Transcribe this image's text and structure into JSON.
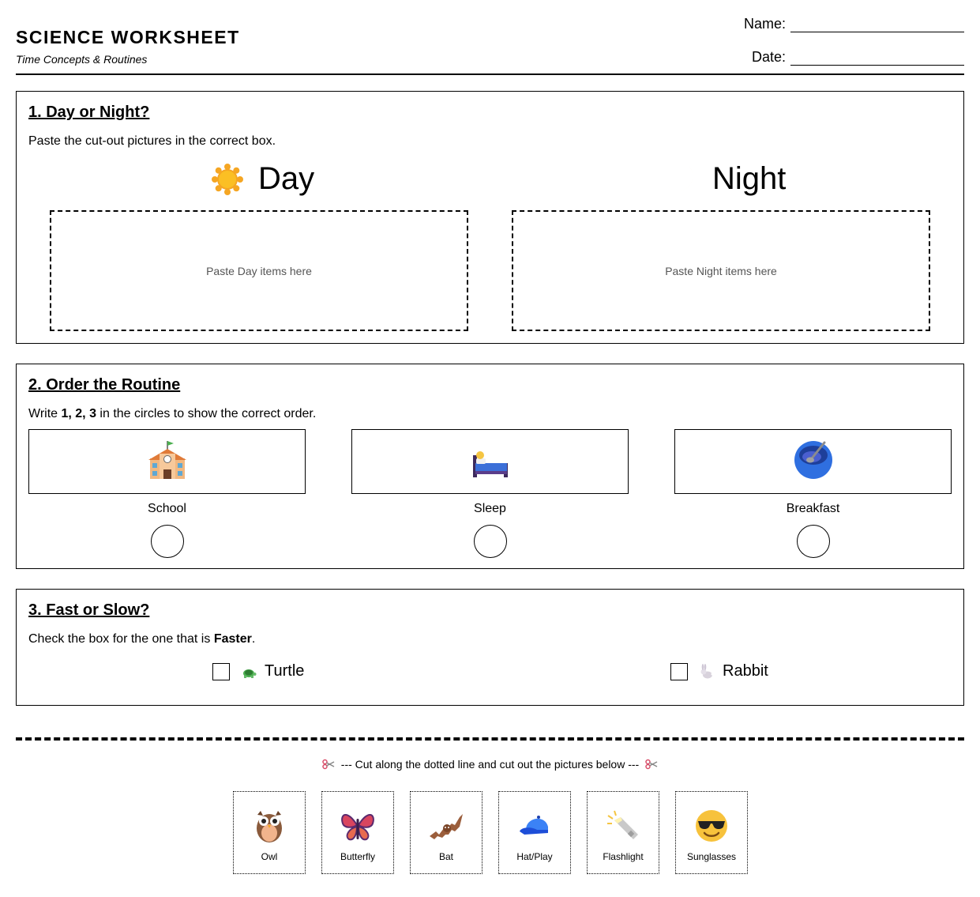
{
  "header": {
    "title": "SCIENCE WORKSHEET",
    "subtitle": "Time Concepts & Routines",
    "name_label": "Name:",
    "date_label": "Date:"
  },
  "section1": {
    "title": "1. Day or Night?",
    "instruction": "Paste the cut-out pictures in the correct box.",
    "day_label": "Day",
    "night_label": "Night",
    "day_icon": "sun-icon",
    "night_icon": "moon-icon",
    "day_box_text": "Paste Day items here",
    "night_box_text": "Paste Night items here"
  },
  "section2": {
    "title": "2. Order the Routine",
    "instruction_prefix": "Write ",
    "instruction_bold": "1, 2, 3",
    "instruction_suffix": " in the circles to show the correct order.",
    "items": [
      {
        "label": "School",
        "icon": "school-icon"
      },
      {
        "label": "Sleep",
        "icon": "bed-icon"
      },
      {
        "label": "Breakfast",
        "icon": "bowl-icon"
      }
    ]
  },
  "section3": {
    "title": "3. Fast or Slow?",
    "instruction_prefix": "Check the box for the one that is ",
    "instruction_bold": "Faster",
    "instruction_suffix": ".",
    "options": [
      {
        "label": "Turtle",
        "icon": "turtle-icon"
      },
      {
        "label": "Rabbit",
        "icon": "rabbit-icon"
      }
    ]
  },
  "cutout": {
    "note": "--- Cut along the dotted line and cut out the pictures below ---",
    "cards": [
      {
        "label": "Owl",
        "icon": "owl-icon"
      },
      {
        "label": "Butterfly",
        "icon": "butterfly-icon"
      },
      {
        "label": "Bat",
        "icon": "bat-icon"
      },
      {
        "label": "Hat/Play",
        "icon": "cap-icon"
      },
      {
        "label": "Flashlight",
        "icon": "flashlight-icon"
      },
      {
        "label": "Sunglasses",
        "icon": "sunglasses-face-icon"
      }
    ]
  },
  "colors": {
    "sun": "#f5a623",
    "moon": "#f3c25e",
    "bowl": "#2f6fe0",
    "cap": "#3b82f6",
    "owl": "#8a5a3b",
    "butterfly": "#d9455f",
    "bat": "#9b5e3c",
    "emoji_face": "#f7c23c"
  }
}
